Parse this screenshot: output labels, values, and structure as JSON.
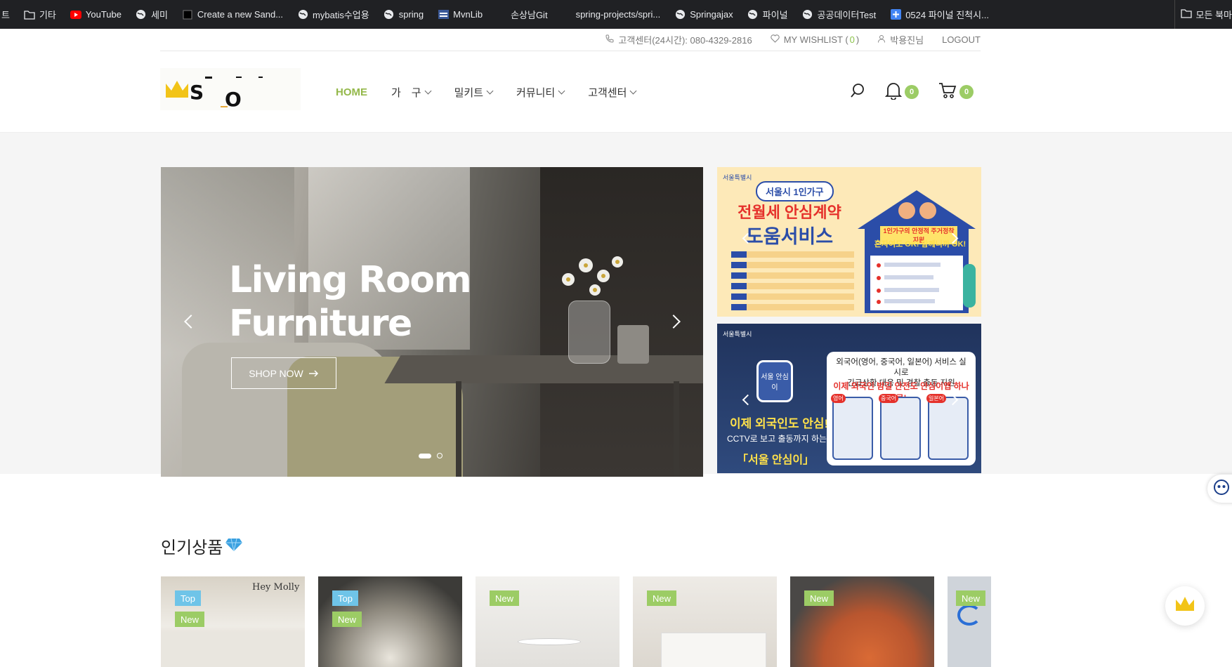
{
  "bookmarks": {
    "items": [
      {
        "label": "트",
        "icon": "none"
      },
      {
        "label": "기타",
        "icon": "folder-icon"
      },
      {
        "label": "YouTube",
        "icon": "youtube-icon"
      },
      {
        "label": "세미",
        "icon": "globe-icon"
      },
      {
        "label": "Create a new Sand...",
        "icon": "page-icon"
      },
      {
        "label": "mybatis수업용",
        "icon": "globe-icon"
      },
      {
        "label": "spring",
        "icon": "globe-icon"
      },
      {
        "label": "MvnLib",
        "icon": "mvn-icon"
      },
      {
        "label": "손상남Git",
        "icon": "none"
      },
      {
        "label": "spring-projects/spri...",
        "icon": "none"
      },
      {
        "label": "Springajax",
        "icon": "globe-icon"
      },
      {
        "label": "파이널",
        "icon": "globe-icon"
      },
      {
        "label": "공공데이터Test",
        "icon": "globe-icon"
      },
      {
        "label": "0524 파이널 진척시...",
        "icon": "plus-doc-icon"
      }
    ],
    "all_bookmarks": "모든 북마"
  },
  "topbar": {
    "service_center": "고객센터(24시간): 080-4329-2816",
    "wishlist_label": "MY WISHLIST (",
    "wishlist_count": "0",
    "wishlist_close": ")",
    "user": "박용진님",
    "logout": "LOGOUT"
  },
  "header": {
    "logo_text": "S O",
    "nav": {
      "home": "HOME",
      "furniture": "가　구",
      "mealkit": "밀키트",
      "community": "커뮤니티",
      "support": "고객센터"
    },
    "notification_count": "0",
    "cart_count": "0"
  },
  "hero": {
    "title_line1": "Living Room",
    "title_line2": "Furniture",
    "button": "SHOP NOW",
    "slide_count": 2,
    "active_slide": 1
  },
  "banner1": {
    "org": "서울특별시",
    "tag": "서울시 1인가구",
    "headline1": "전월세 안심계약",
    "headline2": "도움서비스",
    "house_title": "1인가구의 안정적 주거정착 지원",
    "house_sub": "혼자여도 OK! 함께니까 OK!"
  },
  "banner2": {
    "org": "서울특별시",
    "card_line1": "외국어(영어, 중국어, 일본어) 서비스 실시로",
    "card_line2": "긴급상황 대응 및 경찰 출동 지원",
    "card_highlight": "이제 외국인 밤길 안전도 안심이앱 하나로!",
    "lang1": "영어",
    "lang2": "중국어",
    "lang3": "일본어",
    "logo": "서울 안심이",
    "title": "이제 외국인도 안심!",
    "sub": "CCTV로 보고 출동까지 하는 앱",
    "app": "「서울 안심이」"
  },
  "popular": {
    "title": "인기상품",
    "products": [
      {
        "tags": [
          "Top",
          "New"
        ],
        "caption": "Hey Molly",
        "color": "#d8d2c6"
      },
      {
        "tags": [
          "Top",
          "New"
        ],
        "caption": "",
        "color": "#6b6a66"
      },
      {
        "tags": [
          "New"
        ],
        "caption": "",
        "color": "#ecebe8"
      },
      {
        "tags": [
          "New"
        ],
        "caption": "",
        "color": "#e9e6e1"
      },
      {
        "tags": [
          "New"
        ],
        "caption": "",
        "color": "#b9562f"
      },
      {
        "tags": [
          "New"
        ],
        "caption": "",
        "color": "#cfd4da"
      }
    ]
  },
  "colors": {
    "accent": "#94b84a",
    "badge": "#9ccc65",
    "top_tag": "#6fc4e8"
  }
}
